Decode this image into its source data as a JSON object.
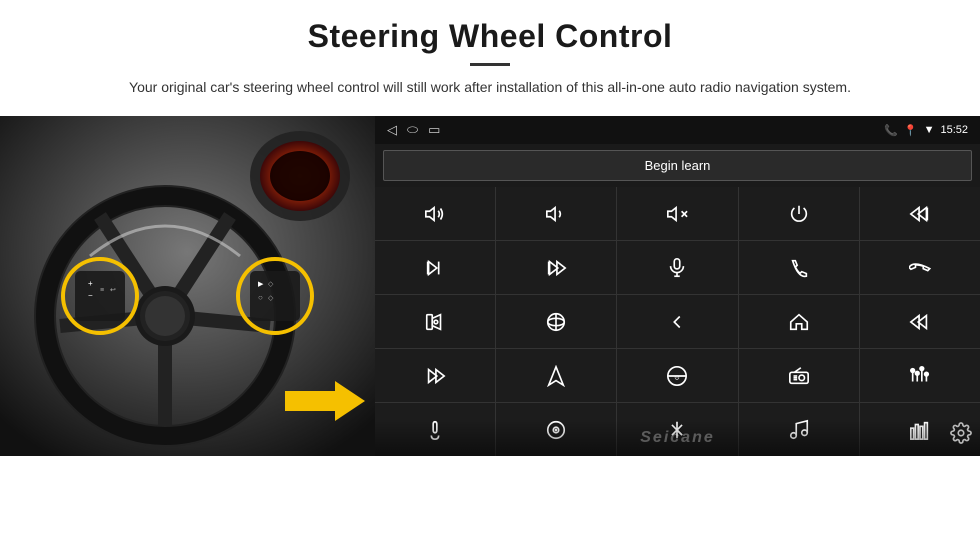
{
  "page": {
    "title": "Steering Wheel Control",
    "divider": true,
    "subtitle": "Your original car's steering wheel control will still work after installation of this all-in-one auto radio navigation system."
  },
  "status_bar": {
    "time": "15:52",
    "back_icon": "◁",
    "home_icon": "⬭",
    "recents_icon": "▭"
  },
  "begin_learn": {
    "label": "Begin learn"
  },
  "grid": {
    "cells": [
      {
        "icon": "vol_up",
        "symbol": "🔊+"
      },
      {
        "icon": "vol_down",
        "symbol": "🔊−"
      },
      {
        "icon": "mute",
        "symbol": "🔇"
      },
      {
        "icon": "power",
        "symbol": "⏻"
      },
      {
        "icon": "prev_track",
        "symbol": "⏮"
      },
      {
        "icon": "next",
        "symbol": "⏭"
      },
      {
        "icon": "skip_fwd",
        "symbol": "⏭"
      },
      {
        "icon": "mic",
        "symbol": "🎙"
      },
      {
        "icon": "phone",
        "symbol": "📞"
      },
      {
        "icon": "hang_up",
        "symbol": "↩"
      },
      {
        "icon": "speaker",
        "symbol": "📢"
      },
      {
        "icon": "360",
        "symbol": "360°"
      },
      {
        "icon": "back_nav",
        "symbol": "↩"
      },
      {
        "icon": "home_nav",
        "symbol": "⌂"
      },
      {
        "icon": "rewind",
        "symbol": "⏮"
      },
      {
        "icon": "fast_fwd",
        "symbol": "⏭"
      },
      {
        "icon": "navigate",
        "symbol": "▶"
      },
      {
        "icon": "eject",
        "symbol": "⏏"
      },
      {
        "icon": "radio",
        "symbol": "📻"
      },
      {
        "icon": "eq",
        "symbol": "⫶"
      },
      {
        "icon": "mic2",
        "symbol": "🎤"
      },
      {
        "icon": "cd",
        "symbol": "⊙"
      },
      {
        "icon": "bluetooth",
        "symbol": "⚡"
      },
      {
        "icon": "music",
        "symbol": "🎵"
      },
      {
        "icon": "eq2",
        "symbol": "⫶"
      }
    ]
  },
  "watermark": {
    "text": "Seicane"
  }
}
